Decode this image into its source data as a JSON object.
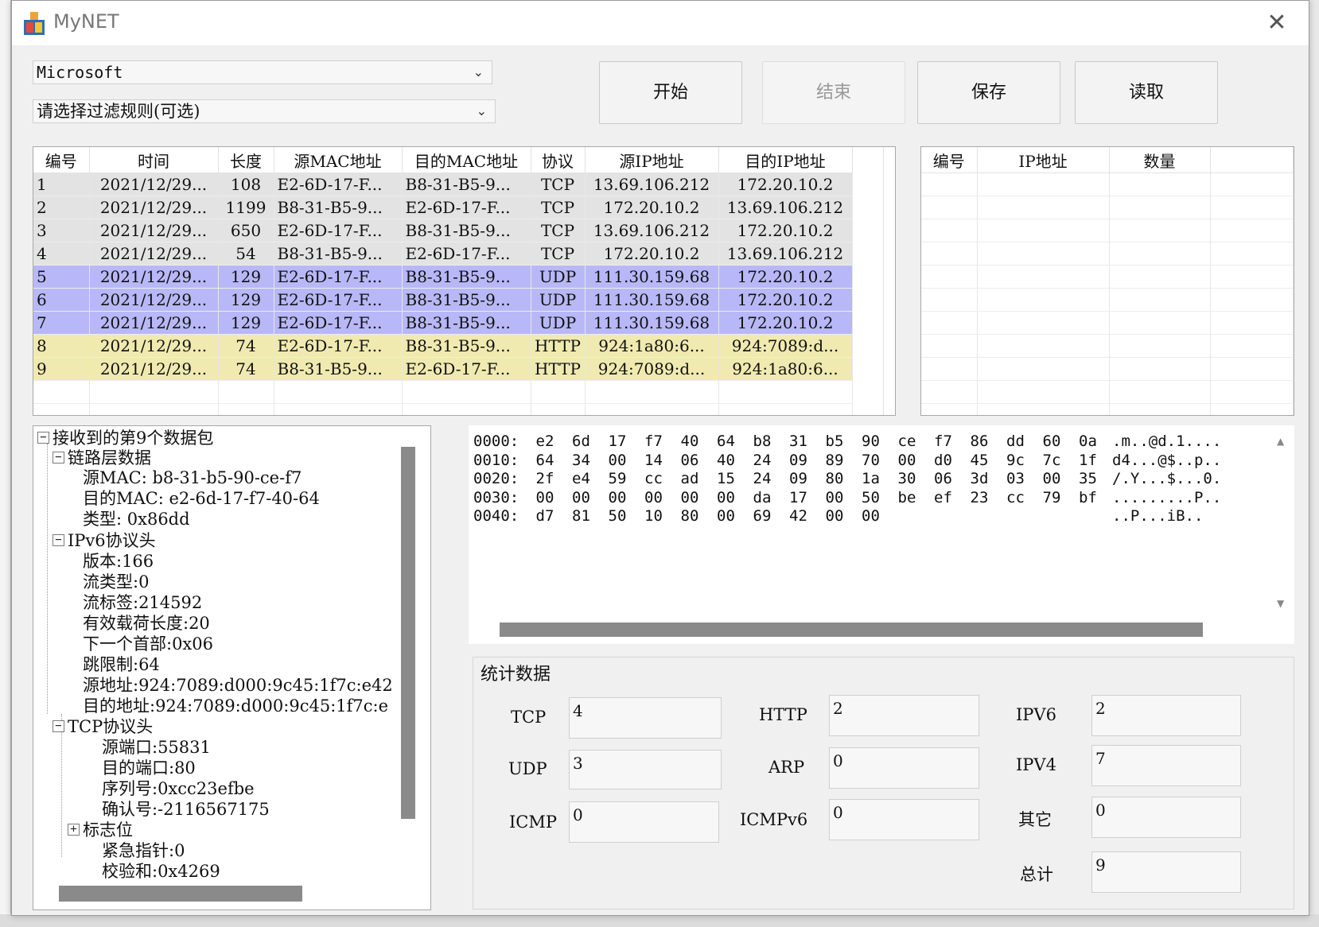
{
  "window": {
    "title": "MyNET",
    "close_glyph": "✕"
  },
  "toolbar": {
    "adapter_value": "Microsoft",
    "filter_placeholder": "请选择过滤规则(可选)",
    "start_label": "开始",
    "stop_label": "结束",
    "save_label": "保存",
    "read_label": "读取"
  },
  "packets": {
    "headers": [
      "编号",
      "时间",
      "长度",
      "源MAC地址",
      "目的MAC地址",
      "协议",
      "源IP地址",
      "目的IP地址"
    ],
    "rows": [
      [
        "1",
        "2021/12/29...",
        "108",
        "E2-6D-17-F...",
        "B8-31-B5-9...",
        "TCP",
        "13.69.106.212",
        "172.20.10.2"
      ],
      [
        "2",
        "2021/12/29...",
        "1199",
        "B8-31-B5-9...",
        "E2-6D-17-F...",
        "TCP",
        "172.20.10.2",
        "13.69.106.212"
      ],
      [
        "3",
        "2021/12/29...",
        "650",
        "E2-6D-17-F...",
        "B8-31-B5-9...",
        "TCP",
        "13.69.106.212",
        "172.20.10.2"
      ],
      [
        "4",
        "2021/12/29...",
        "54",
        "B8-31-B5-9...",
        "E2-6D-17-F...",
        "TCP",
        "172.20.10.2",
        "13.69.106.212"
      ],
      [
        "5",
        "2021/12/29...",
        "129",
        "E2-6D-17-F...",
        "B8-31-B5-9...",
        "UDP",
        "111.30.159.68",
        "172.20.10.2"
      ],
      [
        "6",
        "2021/12/29...",
        "129",
        "E2-6D-17-F...",
        "B8-31-B5-9...",
        "UDP",
        "111.30.159.68",
        "172.20.10.2"
      ],
      [
        "7",
        "2021/12/29...",
        "129",
        "E2-6D-17-F...",
        "B8-31-B5-9...",
        "UDP",
        "111.30.159.68",
        "172.20.10.2"
      ],
      [
        "8",
        "2021/12/29...",
        "74",
        "E2-6D-17-F...",
        "B8-31-B5-9...",
        "HTTP",
        "924:1a80:6...",
        "924:7089:d..."
      ],
      [
        "9",
        "2021/12/29...",
        "74",
        "B8-31-B5-9...",
        "E2-6D-17-F...",
        "HTTP",
        "924:7089:d...",
        "924:1a80:6..."
      ]
    ]
  },
  "ip_table": {
    "headers": [
      "编号",
      "IP地址",
      "数量"
    ]
  },
  "tree": {
    "root": "接收到的第9个数据包",
    "link": "链路层数据",
    "link_src": "源MAC: b8-31-b5-90-ce-f7",
    "link_dst": "目的MAC: e2-6d-17-f7-40-64",
    "link_type": "类型: 0x86dd",
    "ipv6": "IPv6协议头",
    "ipv6_ver": "版本:166",
    "ipv6_class": "流类型:0",
    "ipv6_flow": "流标签:214592",
    "ipv6_payload": "有效载荷长度:20",
    "ipv6_next": "下一个首部:0x06",
    "ipv6_hop": "跳限制:64",
    "ipv6_src": "源地址:924:7089:d000:9c45:1f7c:e42",
    "ipv6_dst": "目的地址:924:7089:d000:9c45:1f7c:e",
    "tcp": "TCP协议头",
    "tcp_sport": "源端口:55831",
    "tcp_dport": "目的端口:80",
    "tcp_seq": "序列号:0xcc23efbe",
    "tcp_ack": "确认号:-2116567175",
    "tcp_flags": "标志位",
    "tcp_urg": "紧急指针:0",
    "tcp_chk": "校验和:0x4269"
  },
  "hex": {
    "rows": [
      {
        "offset": "0000:",
        "bytes": [
          "e2",
          "6d",
          "17",
          "f7",
          "40",
          "64",
          "b8",
          "31",
          "b5",
          "90",
          "ce",
          "f7",
          "86",
          "dd",
          "60",
          "0a"
        ],
        "ascii": ".m..@d.1...."
      },
      {
        "offset": "0010:",
        "bytes": [
          "64",
          "34",
          "00",
          "14",
          "06",
          "40",
          "24",
          "09",
          "89",
          "70",
          "00",
          "d0",
          "45",
          "9c",
          "7c",
          "1f"
        ],
        "ascii": "d4...@$..p.."
      },
      {
        "offset": "0020:",
        "bytes": [
          "2f",
          "e4",
          "59",
          "cc",
          "ad",
          "15",
          "24",
          "09",
          "80",
          "1a",
          "30",
          "06",
          "3d",
          "03",
          "00",
          "35"
        ],
        "ascii": "/.Y...$...0."
      },
      {
        "offset": "0030:",
        "bytes": [
          "00",
          "00",
          "00",
          "00",
          "00",
          "00",
          "da",
          "17",
          "00",
          "50",
          "be",
          "ef",
          "23",
          "cc",
          "79",
          "bf"
        ],
        "ascii": ".........P.."
      },
      {
        "offset": "0040:",
        "bytes": [
          "d7",
          "81",
          "50",
          "10",
          "80",
          "00",
          "69",
          "42",
          "00",
          "00"
        ],
        "ascii": "..P...iB.."
      }
    ]
  },
  "stats": {
    "title": "统计数据",
    "tcp_label": "TCP",
    "tcp_value": "4",
    "udp_label": "UDP",
    "udp_value": "3",
    "icmp_label": "ICMP",
    "icmp_value": "0",
    "http_label": "HTTP",
    "http_value": "2",
    "arp_label": "ARP",
    "arp_value": "0",
    "icmpv6_label": "ICMPv6",
    "icmpv6_value": "0",
    "ipv6_label": "IPV6",
    "ipv6_value": "2",
    "ipv4_label": "IPV4",
    "ipv4_value": "7",
    "other_label": "其它",
    "other_value": "0",
    "total_label": "总计",
    "total_value": "9"
  },
  "colors": {
    "tcp_row": "#e3e3e3",
    "udp_row": "#b8b8f8",
    "http_row": "#f0eab0"
  }
}
